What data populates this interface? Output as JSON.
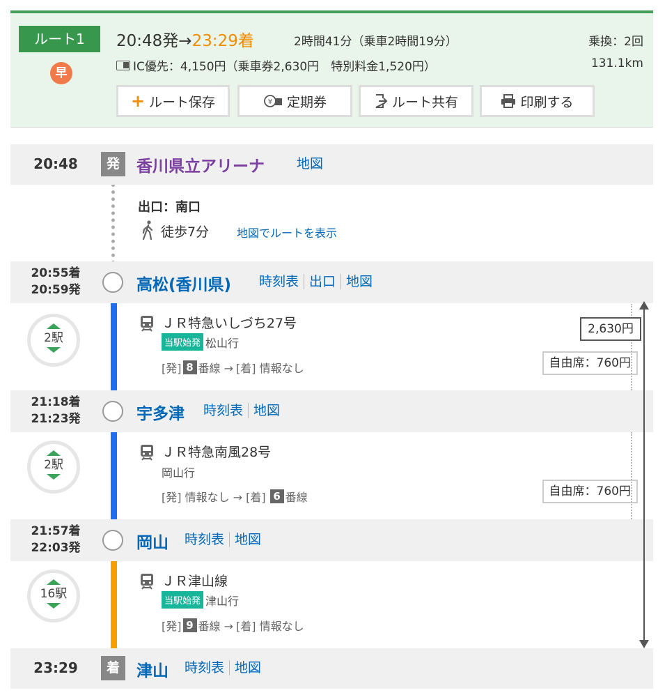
{
  "header": {
    "route_label": "ルート1",
    "haya_icon": "早",
    "dep_time": "20:48発→",
    "arr_time": "23:29着",
    "duration": "2時間41分（乗車2時間19分）",
    "transfers": "乗換：2回",
    "fare": "IC優先：4,150円（乗車券2,630円　特別料金1,520円）",
    "distance": "131.1km",
    "buttons": {
      "save": "ルート保存",
      "commuter": "定期券",
      "share": "ルート共有",
      "print": "印刷する"
    }
  },
  "stations": [
    {
      "times": [
        "20:48"
      ],
      "marker": "発",
      "name": "香川県立アリーナ",
      "links": [
        "地図"
      ]
    },
    {
      "times": [
        "20:55着",
        "20:59発"
      ],
      "name": "高松(香川県)",
      "links": [
        "時刻表",
        "出口",
        "地図"
      ]
    },
    {
      "times": [
        "21:18着",
        "21:23発"
      ],
      "name": "宇多津",
      "links": [
        "時刻表",
        "地図"
      ]
    },
    {
      "times": [
        "21:57着",
        "22:03発"
      ],
      "name": "岡山",
      "links": [
        "時刻表",
        "地図"
      ]
    },
    {
      "times": [
        "23:29"
      ],
      "marker": "着",
      "name": "津山",
      "links": [
        "時刻表",
        "地図"
      ]
    }
  ],
  "walk": {
    "exit": "出口：南口",
    "duration": "徒歩7分",
    "map_link": "地図でルートを表示"
  },
  "legs": [
    {
      "stops": "2駅",
      "train": "ＪＲ特急いしづち27号",
      "origin_badge": "当駅始発",
      "dest": "松山行",
      "plat_dep_label": "[発]",
      "plat_dep": "8",
      "plat_dep_suffix": "番線 →",
      "plat_arr_text": "[着] 情報なし",
      "seat": "自由席：760円",
      "color": "#1e6ff0"
    },
    {
      "stops": "2駅",
      "train": "ＪＲ特急南風28号",
      "dest": "岡山行",
      "plat_text": "[発] 情報なし → [着]",
      "plat_arr": "6",
      "plat_arr_suffix": "番線",
      "seat": "自由席：760円",
      "color": "#1e6ff0"
    },
    {
      "stops": "16駅",
      "train": "ＪＲ津山線",
      "origin_badge": "当駅始発",
      "dest": "津山行",
      "plat_dep_label": "[発]",
      "plat_dep": "9",
      "plat_dep_suffix": "番線 →",
      "plat_arr_text": "[着] 情報なし",
      "color": "#f5a000"
    }
  ],
  "fare_segment": "2,630円"
}
